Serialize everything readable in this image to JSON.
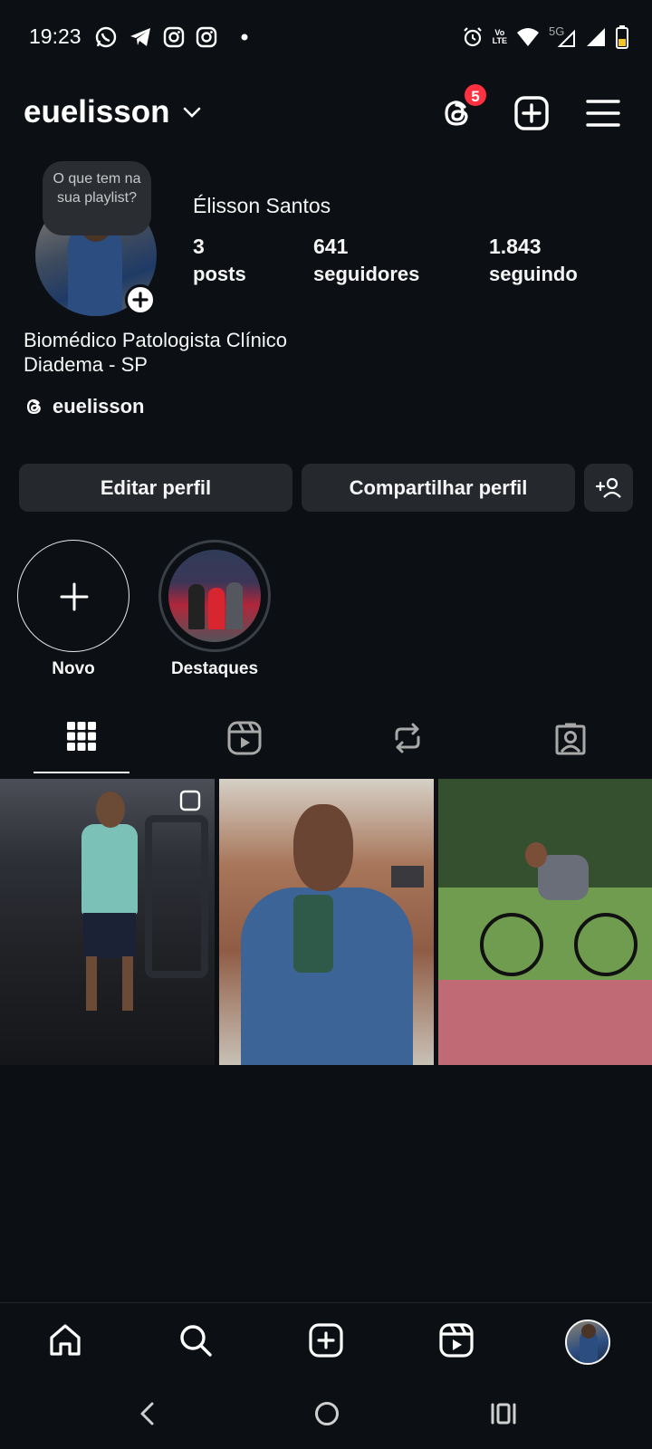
{
  "status_bar": {
    "time": "19:23",
    "left_icons": [
      "whatsapp-icon",
      "telegram-icon",
      "instagram-icon",
      "instagram-icon",
      "dot-icon"
    ],
    "right_icons": [
      "alarm-icon",
      "volte-icon",
      "wifi-icon",
      "signal-5g-icon",
      "signal-icon",
      "battery-icon"
    ],
    "volte_top": "Vo",
    "volte_bottom": "LTE",
    "network": "5G"
  },
  "header": {
    "username": "euelisson",
    "threads_badge": "5"
  },
  "profile": {
    "note": "O que tem na sua playlist?",
    "display_name": "Élisson Santos",
    "stats": [
      {
        "value": "3",
        "label": "posts"
      },
      {
        "value": "641",
        "label": "seguidores"
      },
      {
        "value": "1.843",
        "label": "seguindo"
      }
    ],
    "bio_line1": "Biomédico Patologista Clínico",
    "bio_line2": "Diadema - SP",
    "threads_handle": "euelisson"
  },
  "buttons": {
    "edit": "Editar perfil",
    "share": "Compartilhar perfil"
  },
  "highlights": [
    {
      "label": "Novo"
    },
    {
      "label": "Destaques"
    }
  ],
  "tabs": [
    "grid-icon",
    "reels-icon",
    "reposts-icon",
    "tagged-icon"
  ],
  "colors": {
    "background": "#0c1014",
    "button": "#25292e",
    "badge": "#ff3040",
    "text": "#f5f5f5"
  }
}
